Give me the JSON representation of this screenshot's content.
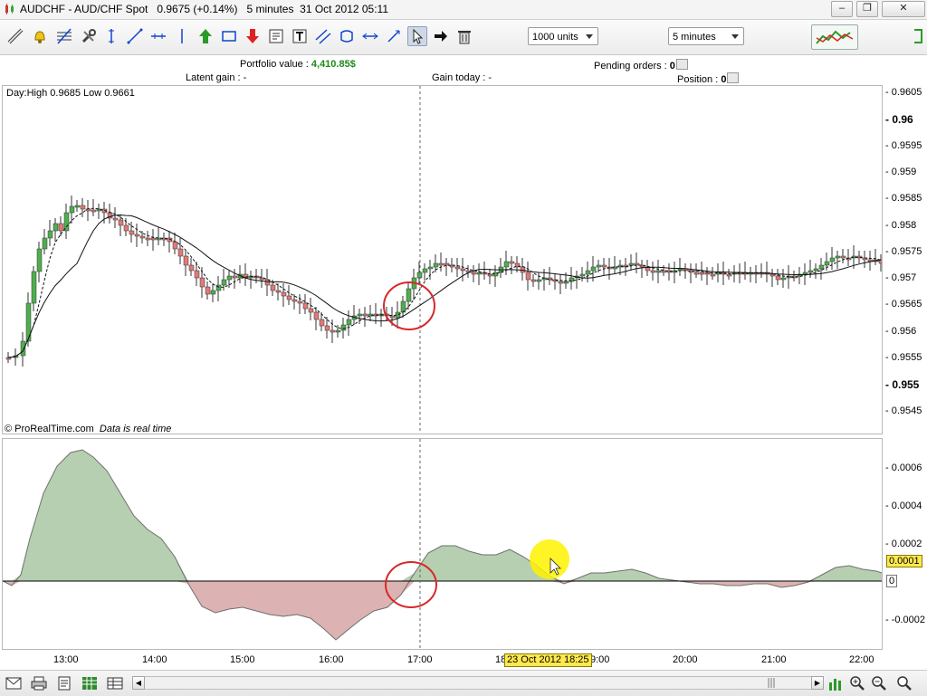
{
  "window": {
    "title": "AUDCHF - AUD/CHF Spot",
    "price": "0.9675 (+0.14%)",
    "timeframe": "5 minutes",
    "datetime": "31 Oct 2012 05:11"
  },
  "toolbar": {
    "tools": [
      "ruler-icon",
      "alarm-icon",
      "fibonacci-icon",
      "settings-tools-icon",
      "vertical-line-icon",
      "trend-line-icon",
      "horizontal-line-icon",
      "cursor-line-icon",
      "buy-arrow-icon",
      "rectangle-icon",
      "sell-arrow-icon",
      "text-note-icon",
      "text-icon",
      "channel-icon",
      "ellipse-icon",
      "segment-icon",
      "draw-icon",
      "pointer-icon",
      "arrow-right-icon",
      "trash-icon"
    ],
    "units_select": "1000 units",
    "timeframe_select": "5 minutes"
  },
  "info": {
    "portfolio_label": "Portfolio value :",
    "portfolio_value": "4,410.85$",
    "pending_label": "Pending orders :",
    "pending_value": "0",
    "latent_label": "Latent gain :",
    "latent_value": "-",
    "gain_today_label": "Gain today :",
    "gain_today_value": "-",
    "position_label": "Position :",
    "position_value": "0"
  },
  "price_panel": {
    "day_info": "Day:High 0.9685 Low 0.9661",
    "watermark": "© ProRealTime.com",
    "realtime": "Data is real time",
    "price_ticks": [
      "0.9605",
      "0.96",
      "0.9595",
      "0.959",
      "0.9585",
      "0.958",
      "0.9575",
      "0.957",
      "0.9565",
      "0.956",
      "0.9555",
      "0.955",
      "0.9545"
    ]
  },
  "indicator_panel": {
    "ticks": [
      "0.0006",
      "0.0004",
      "0.0002",
      "0.0001",
      "0",
      "-0.0002"
    ],
    "current_value": "0.0001"
  },
  "time_axis": {
    "labels": [
      "13:00",
      "14:00",
      "15:00",
      "16:00",
      "17:00",
      "18",
      "9:00",
      "20:00",
      "21:00",
      "22:00"
    ],
    "cursor_label": "23 Oct 2012 18:25"
  },
  "colors": {
    "up_candle": "#4fae4f",
    "down_candle": "#e07a78",
    "osc_positive": "#b5cfb0",
    "osc_negative": "#dcb3b2",
    "value_highlight": "#ffe94d"
  }
}
